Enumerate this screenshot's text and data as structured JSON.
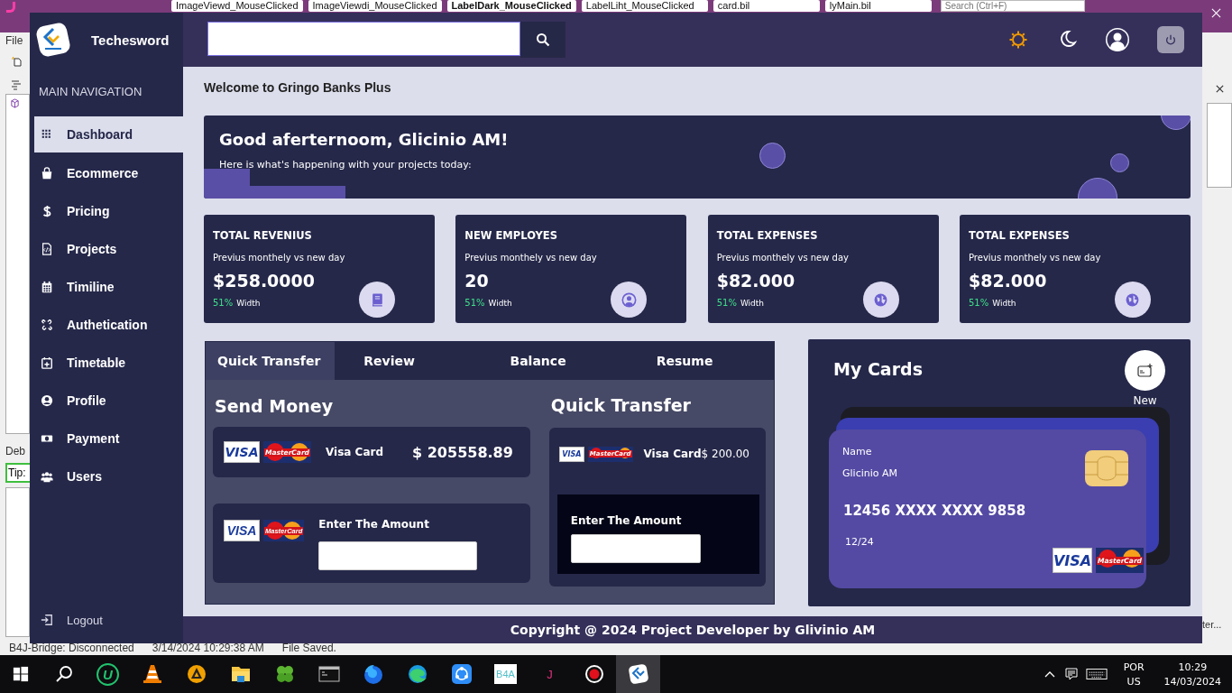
{
  "ide": {
    "tabs": [
      {
        "label": "ImageViewd_MouseClicked",
        "selected": false
      },
      {
        "label": "ImageViewdi_MouseClicked",
        "selected": false
      },
      {
        "label": "LabelDark_MouseClicked",
        "selected": true
      },
      {
        "label": "LabelLiht_MouseClicked",
        "selected": false
      },
      {
        "label": "card.bil",
        "selected": false
      },
      {
        "label": "lyMain.bil",
        "selected": false
      }
    ],
    "search": {
      "placeholder": "Search (Ctrl+F)"
    },
    "menu": "File",
    "left_labels": [
      "Deb",
      "Tip:"
    ],
    "right_label": "ter...",
    "status": [
      "B4J-Bridge: Disconnected",
      "3/14/2024 10:29:38 AM",
      "File Saved."
    ]
  },
  "app": {
    "brand": "Techesword",
    "sidebar": {
      "heading": "MAIN NAVIGATION",
      "items": [
        {
          "label": "Dashboard",
          "kind": "grid",
          "selected": true
        },
        {
          "label": "Ecommerce",
          "kind": "bag",
          "selected": false
        },
        {
          "label": "Pricing",
          "kind": "dollar",
          "selected": false
        },
        {
          "label": "Projects",
          "kind": "file",
          "selected": false
        },
        {
          "label": "Timiline",
          "kind": "calendar",
          "selected": false
        },
        {
          "label": "Authetication",
          "kind": "unlink",
          "selected": false
        },
        {
          "label": "Timetable",
          "kind": "calendar-plus",
          "selected": false
        },
        {
          "label": "Profile",
          "kind": "user",
          "selected": false
        },
        {
          "label": "Payment",
          "kind": "money",
          "selected": false
        },
        {
          "label": "Users",
          "kind": "users",
          "selected": false
        }
      ],
      "logout": "Logout"
    },
    "welcome": "Welcome to Gringo Banks Plus",
    "hero": {
      "title": "Good aferternoom, Glicinio AM!",
      "subtitle": "Here is what's  happening with your projects today:"
    },
    "stats": [
      {
        "title": "TOTAL REVENIUS",
        "subtitle": "Previus monthely vs new day",
        "value": "$258.0000",
        "change": "51%",
        "change_label": "Width",
        "kind": "book"
      },
      {
        "title": "NEW EMPLOYES",
        "subtitle": "Previus monthely vs new day",
        "value": "20",
        "change": "51%",
        "change_label": "Width",
        "kind": "user"
      },
      {
        "title": "TOTAL EXPENSES",
        "subtitle": "Previus monthely vs new day",
        "value": "$82.000",
        "change": "51%",
        "change_label": "Width",
        "kind": "globe"
      },
      {
        "title": "TOTAL EXPENSES",
        "subtitle": "Previus monthely vs new day",
        "value": "$82.000",
        "change": "51%",
        "change_label": "Width",
        "kind": "globe"
      }
    ],
    "transfer_tabs": [
      {
        "label": "Quick Transfer",
        "selected": true
      },
      {
        "label": "Review",
        "selected": false
      },
      {
        "label": "Balance",
        "selected": false
      },
      {
        "label": "Resume",
        "selected": false
      }
    ],
    "send_money": {
      "title": "Send Money",
      "rows": [
        {
          "kind": "card",
          "logos": [
            "VISA",
            "MasterCard"
          ],
          "name": "Visa Card",
          "amount": "$ 205558.89"
        },
        {
          "kind": "amount",
          "logos": [
            "VISA",
            "MasterCard"
          ],
          "label": "Enter The Amount"
        }
      ]
    },
    "quick_transfer": {
      "title": "Quick Transfer",
      "logos": [
        "VISA",
        "MasterCard"
      ],
      "name": "Visa Card",
      "amount": "$ 200.00",
      "amount_label": "Enter The Amount"
    },
    "my_cards": {
      "title": "My Cards",
      "new_label": "New",
      "card": {
        "name_label": "Name",
        "holder": "Glicinio AM",
        "number": "12456 XXXX XXXX 9858",
        "expiry": "12/24",
        "logos": [
          "VISA",
          "MasterCard"
        ]
      }
    },
    "footer": "Copyright @ 2024 Project Developer by Glivinio AM"
  },
  "taskbar": {
    "apps": [
      {
        "kind": "search"
      },
      {
        "kind": "u",
        "label": "U"
      },
      {
        "kind": "cone"
      },
      {
        "kind": "aimp"
      },
      {
        "kind": "folder"
      },
      {
        "kind": "clover"
      },
      {
        "kind": "console"
      },
      {
        "kind": "firefox"
      },
      {
        "kind": "edge"
      },
      {
        "kind": "share"
      },
      {
        "kind": "b4a",
        "label": "B4A"
      },
      {
        "kind": "j",
        "label": "J"
      },
      {
        "kind": "record"
      },
      {
        "kind": "logo",
        "selected": true
      }
    ],
    "language": "POR",
    "layout": "US",
    "time": "10:29",
    "date": "14/03/2024"
  }
}
